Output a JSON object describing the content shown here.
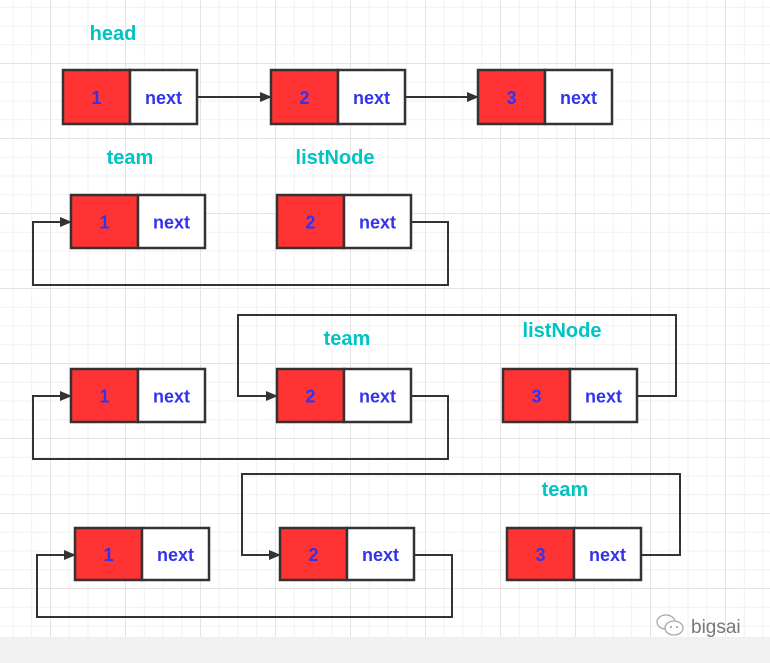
{
  "colors": {
    "node_value_fill": "#ff3333",
    "node_next_fill": "#ffffff",
    "text": "#3333ee",
    "label": "#00c3c3",
    "line": "#333333"
  },
  "next_label": "next",
  "rows": [
    {
      "labels": [
        "head"
      ],
      "nodes": [
        "1",
        "2",
        "3"
      ]
    },
    {
      "labels": [
        "team",
        "listNode"
      ],
      "nodes": [
        "1",
        "2"
      ]
    },
    {
      "labels": [
        "team",
        "listNode"
      ],
      "nodes": [
        "1",
        "2",
        "3"
      ]
    },
    {
      "labels": [
        "team"
      ],
      "nodes": [
        "1",
        "2",
        "3"
      ]
    }
  ],
  "watermark": {
    "icon": "wechat-icon",
    "text": "bigsai"
  }
}
